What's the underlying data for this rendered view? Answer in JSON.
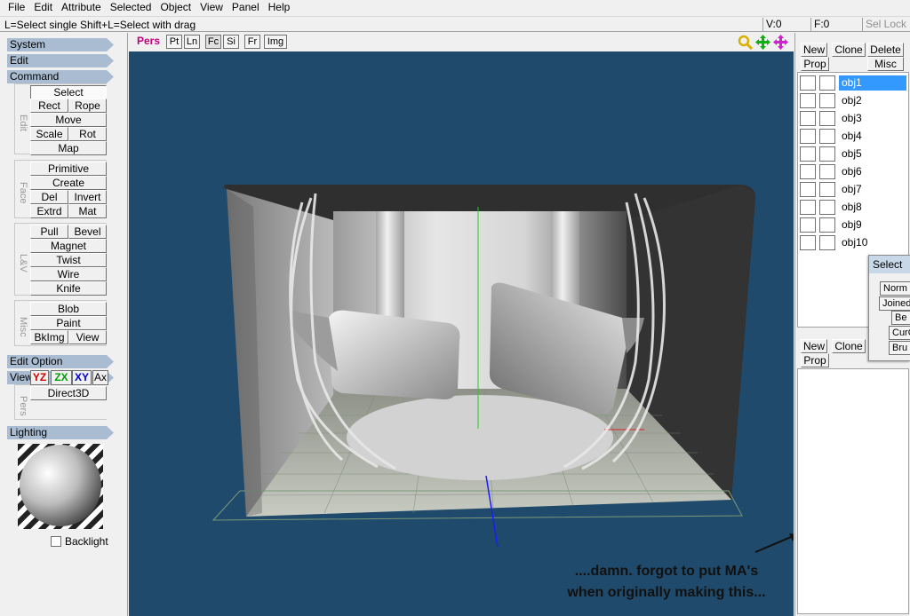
{
  "menubar": {
    "items": [
      "File",
      "Edit",
      "Attribute",
      "Selected",
      "Object",
      "View",
      "Panel",
      "Help"
    ]
  },
  "statusbar": {
    "hint": "L=Select single  Shift+L=Select with drag",
    "v": "V:0",
    "f": "F:0",
    "sel_lock": "Sel Lock"
  },
  "left": {
    "system": "System",
    "edit": "Edit",
    "command": "Command",
    "edit_group": {
      "label": "Edit",
      "select": "Select",
      "rect": "Rect",
      "rope": "Rope",
      "move": "Move",
      "scale": "Scale",
      "rot": "Rot",
      "map": "Map"
    },
    "face_group": {
      "label": "Face",
      "primitive": "Primitive",
      "create": "Create",
      "del": "Del",
      "invert": "Invert",
      "extrd": "Extrd",
      "mat": "Mat"
    },
    "lv_group": {
      "label": "L&V",
      "pull": "Pull",
      "bevel": "Bevel",
      "magnet": "Magnet",
      "twist": "Twist",
      "wire": "Wire",
      "knife": "Knife"
    },
    "misc_group": {
      "label": "Misc",
      "blob": "Blob",
      "paint": "Paint",
      "bkimg": "BkImg",
      "view": "View"
    },
    "edit_option": "Edit Option",
    "view": "View",
    "pers_group": {
      "label": "Pers",
      "direct3d": "Direct3D",
      "yz": "YZ",
      "zx": "ZX",
      "xy": "XY",
      "ax": "Ax"
    },
    "lighting": "Lighting",
    "backlight": "Backlight"
  },
  "viewport": {
    "mode": "Pers",
    "buttons": [
      "Pt",
      "Ln",
      "Fc",
      "Si",
      "Fr",
      "Img"
    ],
    "annotation_line1": "....damn. forgot to put MA's",
    "annotation_line2": "when originally making this..."
  },
  "right": {
    "new": "New",
    "clone": "Clone",
    "delete": "Delete",
    "prop": "Prop",
    "misc": "Misc",
    "objects": [
      "obj1",
      "obj2",
      "obj3",
      "obj4",
      "obj5",
      "obj6",
      "obj7",
      "obj8",
      "obj9",
      "obj10"
    ],
    "mat_new": "New",
    "mat_clone": "Clone",
    "mat_prop": "Prop"
  },
  "select_window": {
    "title": "Select",
    "items": [
      "Norm",
      "Joined",
      "Be",
      "CurO",
      "Bru"
    ]
  },
  "colors": {
    "viewport_bg": "#1f4a6b",
    "header": "#a9bcd1",
    "selection": "#3399ff",
    "pers_label": "#c0007a"
  }
}
